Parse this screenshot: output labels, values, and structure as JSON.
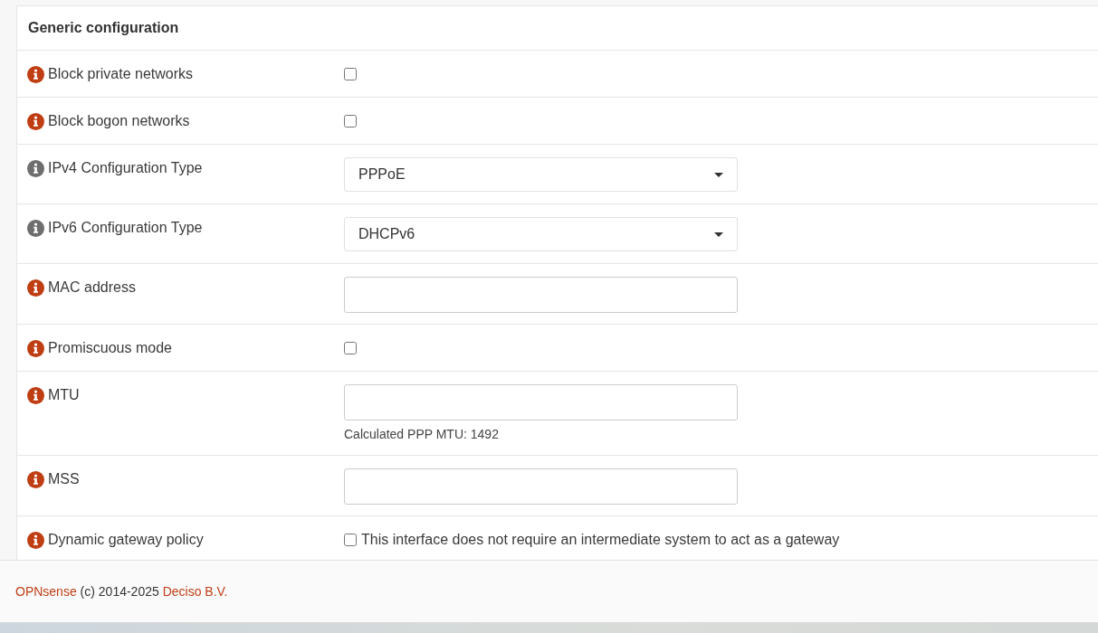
{
  "section": {
    "title": "Generic configuration",
    "rows": [
      {
        "kind": "checkbox",
        "label": "Block private networks",
        "color": "#c03e14",
        "checked": false
      },
      {
        "kind": "checkbox",
        "label": "Block bogon networks",
        "color": "#c03e14",
        "checked": false
      },
      {
        "kind": "select",
        "label": "IPv4 Configuration Type",
        "color": "#6e6e6e",
        "value": "PPPoE"
      },
      {
        "kind": "select",
        "label": "IPv6 Configuration Type",
        "color": "#6e6e6e",
        "value": "DHCPv6"
      },
      {
        "kind": "text",
        "label": "MAC address",
        "color": "#c03e14"
      },
      {
        "kind": "checkbox",
        "label": "Promiscuous mode",
        "color": "#c03e14",
        "checked": false
      },
      {
        "kind": "text",
        "label": "MTU",
        "color": "#c03e14",
        "help": "Calculated PPP MTU: 1492"
      },
      {
        "kind": "text",
        "label": "MSS",
        "color": "#c03e14"
      },
      {
        "kind": "checkbox",
        "label": "Dynamic gateway policy",
        "color": "#c03e14",
        "checked": false,
        "option_label": "This interface does not require an intermediate system to act as a gateway"
      }
    ]
  },
  "footer": {
    "brand": "OPNsense",
    "copyright": "(c) 2014-2025",
    "company": "Deciso B.V."
  }
}
